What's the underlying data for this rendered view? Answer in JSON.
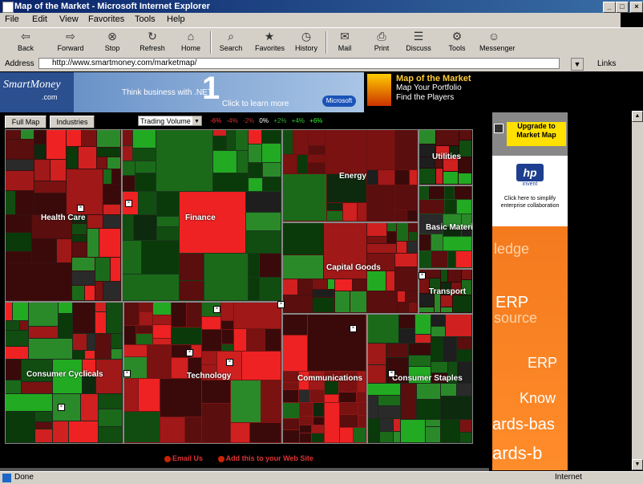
{
  "window": {
    "title": "Map of the Market - Microsoft Internet Explorer"
  },
  "menu": [
    "File",
    "Edit",
    "View",
    "Favorites",
    "Tools",
    "Help"
  ],
  "toolbar": [
    {
      "label": "Back",
      "icon": "arrow-left-icon"
    },
    {
      "label": "Forward",
      "icon": "arrow-right-icon"
    },
    {
      "label": "Stop",
      "icon": "stop-icon"
    },
    {
      "label": "Refresh",
      "icon": "refresh-icon"
    },
    {
      "label": "Home",
      "icon": "home-icon"
    },
    {
      "label": "Search",
      "icon": "search-icon"
    },
    {
      "label": "Favorites",
      "icon": "favorites-icon"
    },
    {
      "label": "History",
      "icon": "history-icon"
    },
    {
      "label": "Mail",
      "icon": "mail-icon"
    },
    {
      "label": "Print",
      "icon": "print-icon"
    },
    {
      "label": "Discuss",
      "icon": "discuss-icon"
    },
    {
      "label": "Tools",
      "icon": "tools-icon"
    },
    {
      "label": "Messenger",
      "icon": "messenger-icon"
    }
  ],
  "address": {
    "label": "Address",
    "value": "http://www.smartmoney.com/marketmap/",
    "links": "Links"
  },
  "banner": {
    "brand": "SmartMoney",
    "brand_sub": ".com",
    "ad_text": "Think business with .NET",
    "ad_big": "1",
    "ad_cta": "Click to learn more",
    "ad_badge": "Microsoft",
    "map_title": "Map of the Market",
    "map_items": [
      "Map Your Portfolio",
      "Find the Players"
    ]
  },
  "controls": {
    "btn1": "Full Map",
    "btn2": "Industries",
    "select": "Trading Volume",
    "scale": [
      "-6%",
      "-4%",
      "-2%",
      "0%",
      "+2%",
      "+4%",
      "+6%"
    ]
  },
  "sectors": [
    {
      "name": "Health Care"
    },
    {
      "name": "Finance"
    },
    {
      "name": "Energy"
    },
    {
      "name": "Utilities"
    },
    {
      "name": "Basic Materials"
    },
    {
      "name": "Capital Goods"
    },
    {
      "name": "Transport"
    },
    {
      "name": "Consumer Cyclicals"
    },
    {
      "name": "Technology"
    },
    {
      "name": "Communications"
    },
    {
      "name": "Consumer Staples"
    }
  ],
  "footer": {
    "left": "Email Us",
    "right": "Add this to your Web Site"
  },
  "sidebar_ad": {
    "upgrade_title": "Upgrade to Market Map",
    "hp_logo": "hp",
    "hp_sub": "invent",
    "hp_text": "Click here to simplify enterprise collaboration",
    "orange_words": [
      "ledge",
      "ERP",
      "source",
      "ERP",
      "Know",
      "ards-bas",
      "ards-b"
    ]
  },
  "status": {
    "text": "Done",
    "zone": "Internet"
  }
}
